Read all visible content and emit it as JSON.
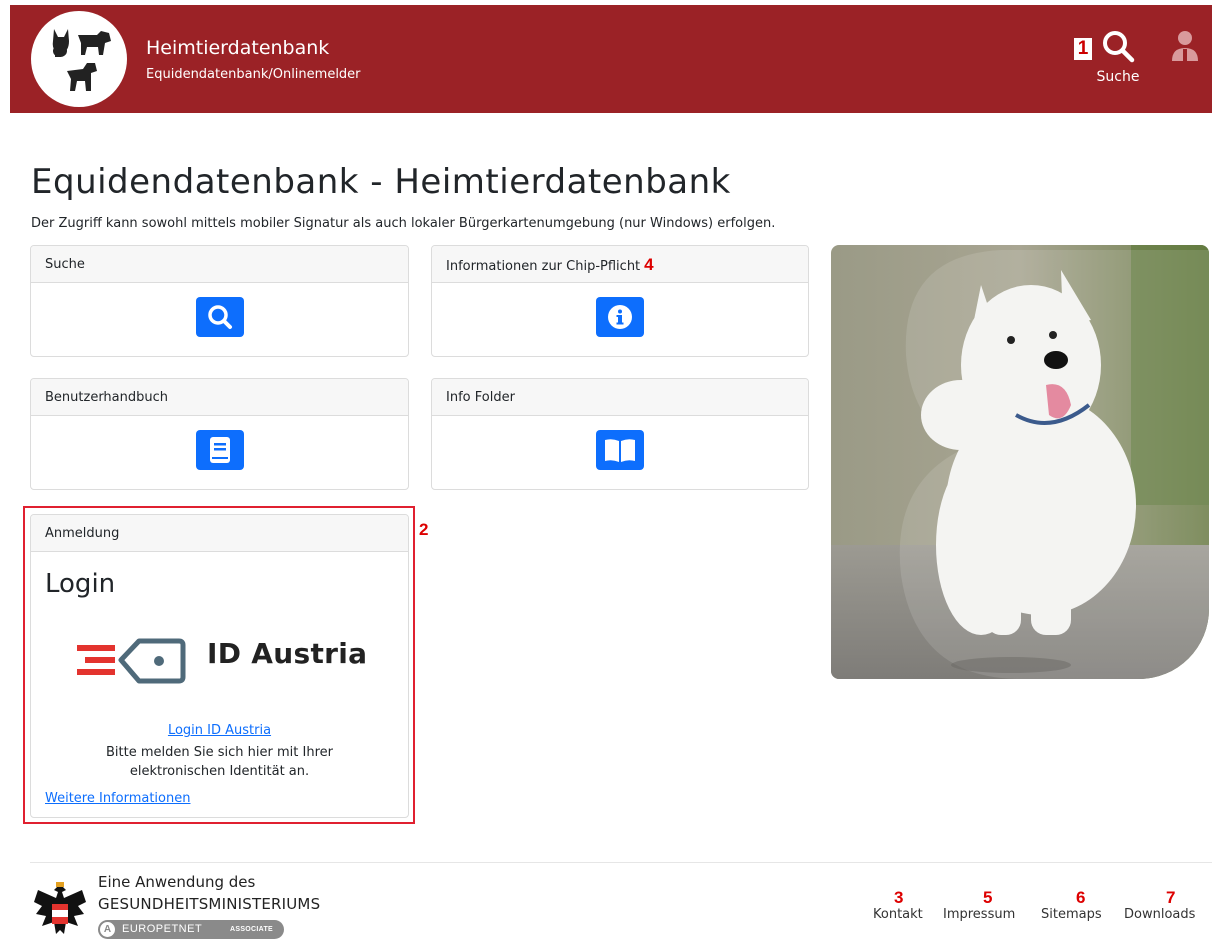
{
  "header": {
    "title": "Heimtierdatenbank",
    "subtitle": "Equidendatenbank/Onlinemelder",
    "search_label": "Suche",
    "marker_1": "1",
    "background_color": "#9b2226"
  },
  "main": {
    "title": "Equidendatenbank - Heimtierdatenbank",
    "description": "Der Zugriff kann sowohl mittels mobiler Signatur als auch lokaler Bürgerkartenumgebung (nur Windows) erfolgen.",
    "cards": {
      "search": {
        "header": "Suche",
        "icon": "search-icon"
      },
      "chip": {
        "header": "Informationen zur Chip-Pflicht",
        "marker": "4",
        "icon": "info-icon"
      },
      "manual": {
        "header": "Benutzerhandbuch",
        "icon": "book-icon"
      },
      "folder": {
        "header": "Info Folder",
        "icon": "open-book-icon"
      }
    },
    "login": {
      "header": "Anmeldung",
      "marker": "2",
      "title": "Login",
      "brand": "ID Austria",
      "link": "Login ID Austria",
      "text": "Bitte melden Sie sich hier mit Ihrer elektronischen Identität an.",
      "more": "Weitere Informationen"
    },
    "accent_color": "#0d6efd"
  },
  "footer": {
    "line1": "Eine Anwendung des",
    "line2": "GESUNDHEITSMINISTERIUMS",
    "badge_letter": "A",
    "badge_name": "EUROPETNET",
    "badge_tag": "ASSOCIATE",
    "links": [
      {
        "num": "3",
        "label": "Kontakt"
      },
      {
        "num": "5",
        "label": "Impressum"
      },
      {
        "num": "6",
        "label": "Sitemaps"
      },
      {
        "num": "7",
        "label": "Downloads"
      }
    ]
  }
}
